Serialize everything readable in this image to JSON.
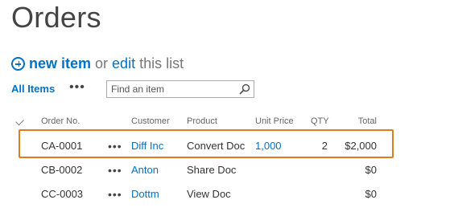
{
  "page": {
    "title": "Orders"
  },
  "actions": {
    "new_item": "new item",
    "or": "or",
    "edit": "edit",
    "this_list": "this list"
  },
  "views": {
    "current": "All Items",
    "more": "•••",
    "search_placeholder": "Find an item"
  },
  "table": {
    "headers": {
      "check": "✓",
      "order_no": "Order No.",
      "customer": "Customer",
      "product": "Product",
      "unit_price": "Unit Price",
      "qty": "QTY",
      "total": "Total"
    },
    "rows": [
      {
        "order_no": "CA-0001",
        "menu": "•••",
        "customer": "Diff Inc",
        "product": "Convert Doc",
        "unit_price": "1,000",
        "qty": "2",
        "total": "$2,000"
      },
      {
        "order_no": "CB-0002",
        "menu": "•••",
        "customer": "Anton",
        "product": "Share Doc",
        "unit_price": "",
        "qty": "",
        "total": "$0"
      },
      {
        "order_no": "CC-0003",
        "menu": "•••",
        "customer": "Dottm",
        "product": "View Doc",
        "unit_price": "",
        "qty": "",
        "total": "$0"
      }
    ]
  },
  "colors": {
    "link": "#0072c6",
    "highlight_border": "#e07c21"
  }
}
